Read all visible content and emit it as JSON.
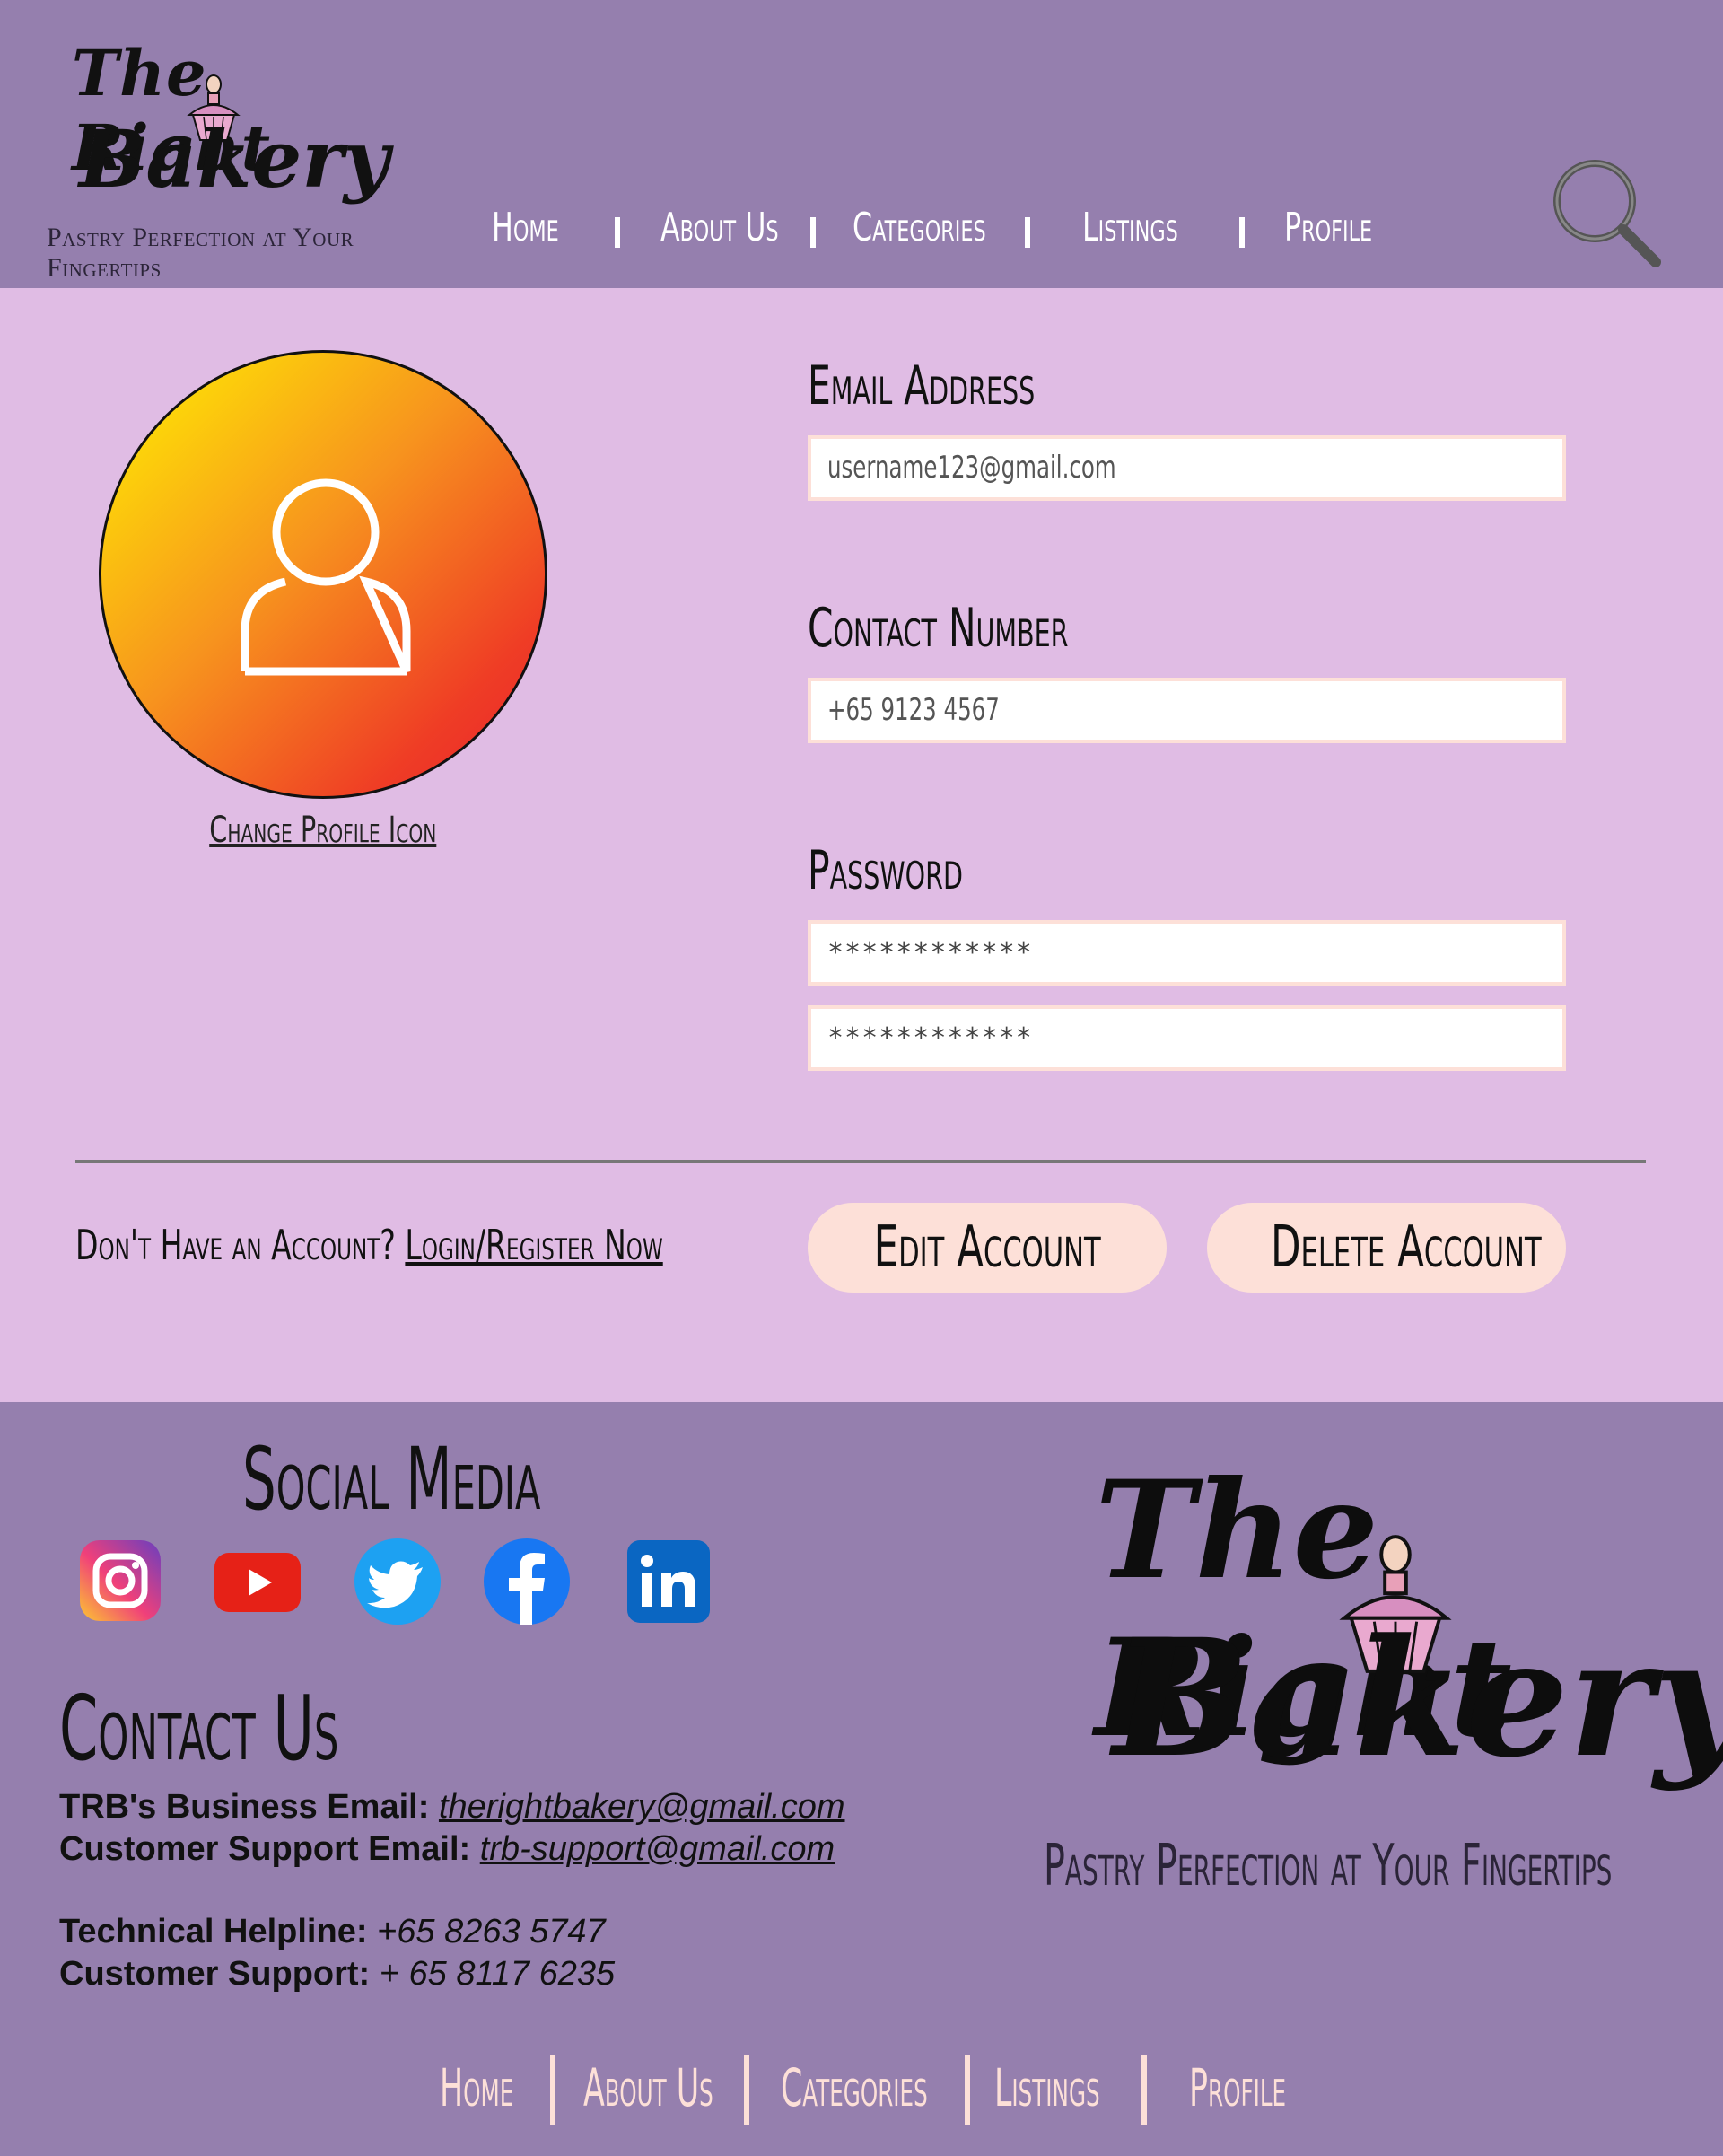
{
  "brand": {
    "logo_line1": "The Right",
    "logo_line2": "Bakery",
    "tagline": "Pastry Perfection at Your Fingertips"
  },
  "nav": {
    "items": [
      "Home",
      "About Us",
      "Categories",
      "Listings",
      "Profile"
    ]
  },
  "icons": {
    "search": "search-icon",
    "avatar": "user-icon"
  },
  "profile": {
    "change_icon_label": "Change Profile Icon",
    "email_label": "Email Address",
    "email_value": "username123@gmail.com",
    "contact_label": "Contact Number",
    "contact_value": "+65 9123 4567",
    "password_label": "Password",
    "password_value": "************",
    "password_confirm_value": "************"
  },
  "account": {
    "prompt": "Don't Have an Account?",
    "link": "Login/Register Now",
    "edit_label": "Edit Account",
    "delete_label": "Delete Account"
  },
  "footer": {
    "social_title": "Social Media",
    "social": [
      "instagram-icon",
      "youtube-icon",
      "twitter-icon",
      "facebook-icon",
      "linkedin-icon"
    ],
    "contact_title": "Contact Us",
    "business_email_label": "TRB's Business Email:",
    "business_email": "therightbakery@gmail.com",
    "support_email_label": "Customer Support Email:",
    "support_email": "trb-support@gmail.com",
    "helpline_label": "Technical Helpline:",
    "helpline": "+65 8263 5747",
    "support_phone_label": "Customer Support:",
    "support_phone": "+ 65 8117 6235"
  },
  "colors": {
    "header_bg": "#957fae",
    "page_bg": "#e0bce4",
    "button_bg": "#fde0d8",
    "avatar_gradient_start": "#fff200",
    "avatar_gradient_end": "#e8202f"
  }
}
